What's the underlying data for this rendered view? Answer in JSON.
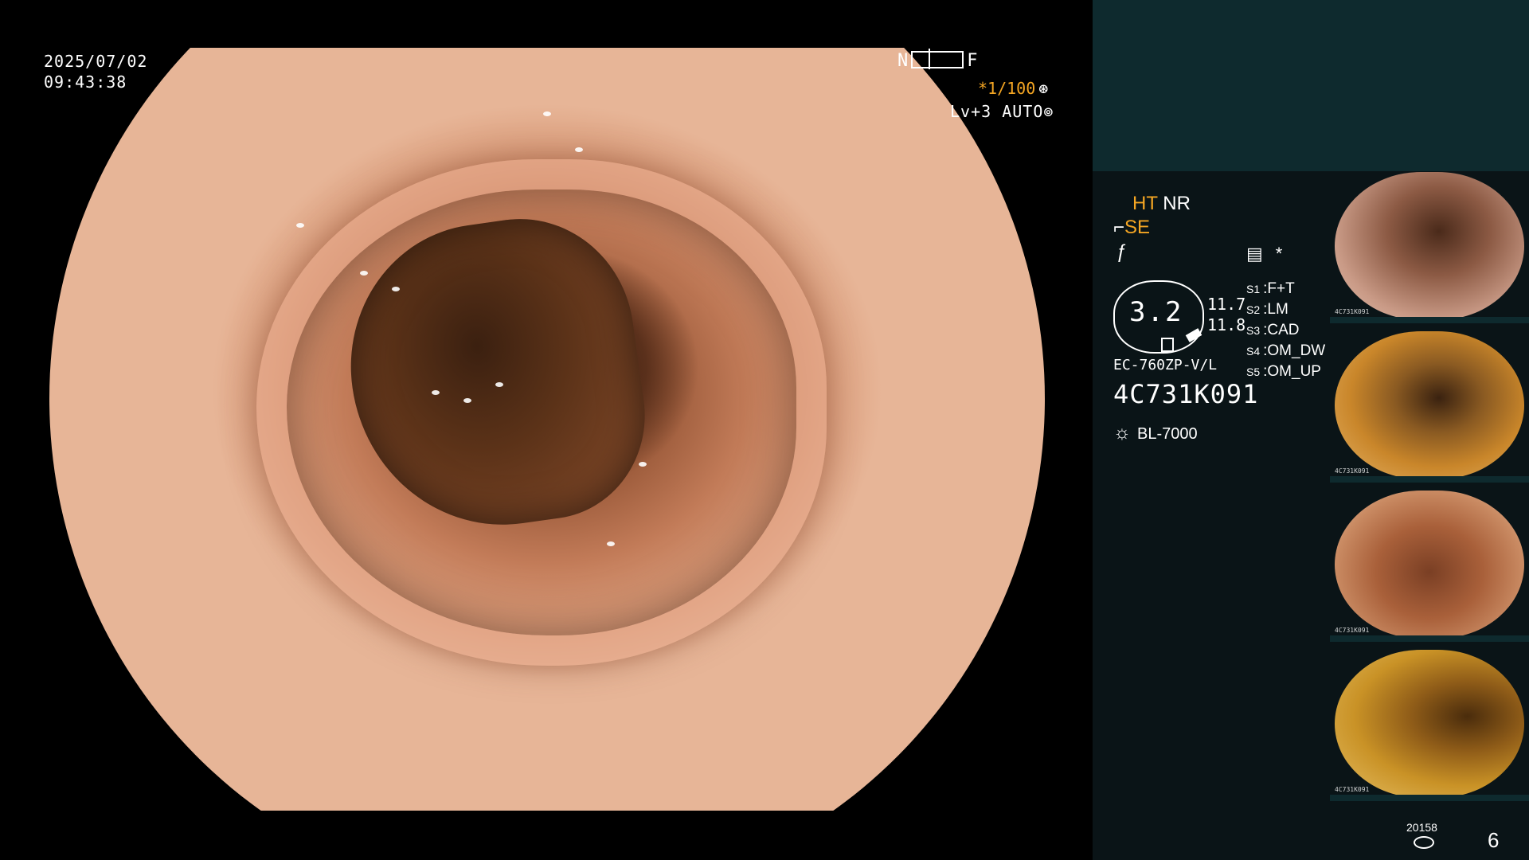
{
  "overlay": {
    "date": "2025/07/02",
    "time": "09:43:38",
    "nf_left": "N",
    "nf_right": "F",
    "shutter": "*1/100",
    "shutter_icon": "iris-icon",
    "level": "Lv+3",
    "auto": "AUTO",
    "auto_icon": "auto-iris-icon"
  },
  "settings": {
    "ht": "HT",
    "nr": "NR",
    "se_icon": "scope-icon",
    "se": "SE",
    "mode_icon": "f-icon",
    "menu_icon": "menu-icon",
    "asterisk": "*",
    "gauge_value": "3.2",
    "val1": "11.7",
    "val2": "11.8",
    "slots": [
      {
        "key": "S1",
        "value": "F+T"
      },
      {
        "key": "S2",
        "value": "LM"
      },
      {
        "key": "S3",
        "value": "CAD"
      },
      {
        "key": "S4",
        "value": "OM_DW"
      },
      {
        "key": "S5",
        "value": "OM_UP"
      }
    ],
    "scope_model": "EC-760ZP-V/L",
    "serial": "4C731K091",
    "light_source": "BL-7000",
    "light_icon": "sun-icon"
  },
  "thumbnails": [
    {
      "label": "4C731K091"
    },
    {
      "label": "4C731K091"
    },
    {
      "label": "4C731K091"
    },
    {
      "label": "4C731K091"
    }
  ],
  "footer": {
    "count": "20158",
    "page": "6",
    "icon": "storage-icon"
  },
  "colors": {
    "accent": "#f5a623",
    "panel": "#0a1417",
    "panel_top": "#0e2a2e"
  }
}
